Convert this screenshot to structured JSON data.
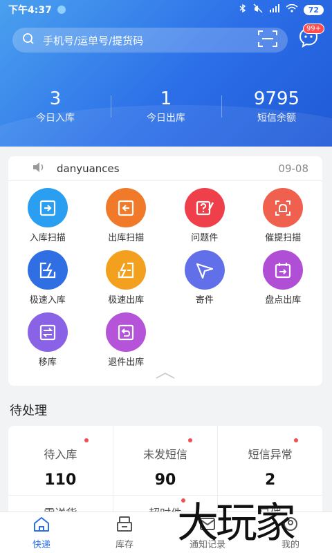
{
  "statusbar": {
    "time": "下午4:37",
    "battery": "72"
  },
  "search": {
    "placeholder": "手机号/运单号/提货码",
    "badge": "99+"
  },
  "stats": [
    {
      "value": "3",
      "label": "今日入库"
    },
    {
      "value": "1",
      "label": "今日出库"
    },
    {
      "value": "9795",
      "label": "短信余额"
    }
  ],
  "notice": {
    "text": "danyuances",
    "date": "09-08"
  },
  "actions": [
    {
      "label": "入库扫描",
      "icon": "inbound-scan-icon",
      "color": "#2a9ef0"
    },
    {
      "label": "出库扫描",
      "icon": "outbound-scan-icon",
      "color": "#f07a2a"
    },
    {
      "label": "问题件",
      "icon": "problem-icon",
      "color": "#ee3f4a"
    },
    {
      "label": "催提扫描",
      "icon": "urge-pickup-icon",
      "color": "#f0604f"
    },
    {
      "label": "极速入库",
      "icon": "fast-inbound-icon",
      "color": "#2f6fe3"
    },
    {
      "label": "极速出库",
      "icon": "fast-outbound-icon",
      "color": "#f4a01f"
    },
    {
      "label": "寄件",
      "icon": "send-icon",
      "color": "#6170e8"
    },
    {
      "label": "盘点出库",
      "icon": "inventory-out-icon",
      "color": "#b04ed6"
    },
    {
      "label": "移库",
      "icon": "transfer-icon",
      "color": "#8a62e6"
    },
    {
      "label": "退件出库",
      "icon": "return-icon",
      "color": "#b554d8"
    }
  ],
  "pending": {
    "title": "待处理",
    "items": [
      {
        "label": "待入库",
        "value": "110"
      },
      {
        "label": "未发短信",
        "value": "90"
      },
      {
        "label": "短信异常",
        "value": "2"
      }
    ],
    "row2": [
      "需送货",
      "超时件",
      "已催"
    ]
  },
  "tabs": [
    {
      "label": "快递",
      "icon": "home-icon"
    },
    {
      "label": "库存",
      "icon": "inventory-icon"
    },
    {
      "label": "通知记录",
      "icon": "mail-icon"
    },
    {
      "label": "我的",
      "icon": "profile-icon"
    }
  ],
  "watermark": "大玩家",
  "colors": {
    "accent": "#2a6fe6",
    "red_dot": "#f05050"
  }
}
